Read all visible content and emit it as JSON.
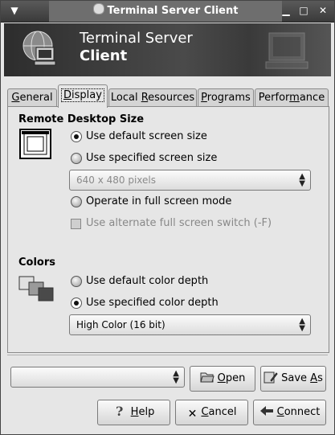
{
  "window": {
    "title": "Terminal Server Client"
  },
  "banner": {
    "line1": "Terminal Server",
    "line2": "Client"
  },
  "tabs": [
    {
      "label": "General",
      "mnemonic_index": 0
    },
    {
      "label": "Display",
      "mnemonic_index": 0
    },
    {
      "label": "Local Resources",
      "mnemonic_index": 6
    },
    {
      "label": "Programs",
      "mnemonic_index": 0
    },
    {
      "label": "Performance",
      "mnemonic_index": 8
    }
  ],
  "display": {
    "remote_section": "Remote Desktop Size",
    "opt_default_size": "Use default screen size",
    "opt_specified_size": "Use specified screen size",
    "size_value": "640 x 480 pixels",
    "opt_fullscreen": "Operate in full screen mode",
    "alt_switch": "Use alternate full screen switch (-F)",
    "colors_section": "Colors",
    "opt_default_depth": "Use default color depth",
    "opt_specified_depth": "Use specified color depth",
    "depth_value": "High Color (16 bit)"
  },
  "bottom": {
    "profile_value": "",
    "open": "Open",
    "save_as": "Save As",
    "help": "Help",
    "cancel": "Cancel",
    "connect": "Connect"
  }
}
